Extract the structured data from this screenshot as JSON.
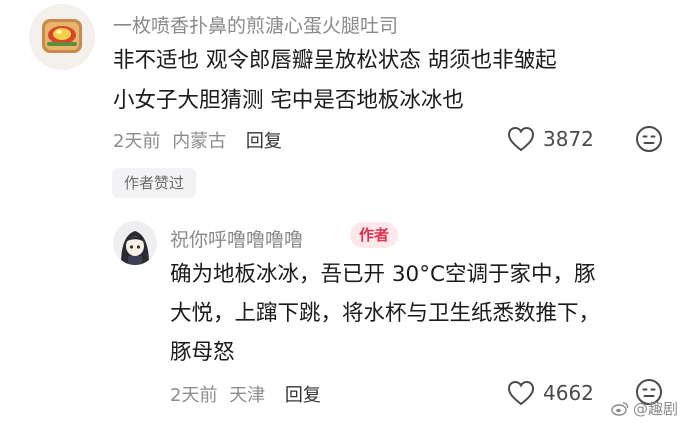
{
  "comment": {
    "username": "一枚喷香扑鼻的煎溏心蛋火腿吐司",
    "lines": [
      "非不适也  观令郎唇瓣呈放松状态  胡须也非皱起",
      "小女子大胆猜测  宅中是否地板冰冰也"
    ],
    "time": "2天前",
    "location": "内蒙古",
    "reply_label": "回复",
    "likes": "3872"
  },
  "author_liked": "作者赞过",
  "reply": {
    "username": "祝你呼噜噜噜噜",
    "badge": "作者",
    "lines": [
      "确为地板冰冰，吾已开 30°C空调于家中，豚",
      "大悦，上蹿下跳，将水杯与卫生纸悉数推下，",
      "豚母怒"
    ],
    "time": "2天前",
    "location": "天津",
    "reply_label": "回复",
    "likes": "4662"
  },
  "watermark": "@趣剧",
  "icons": {
    "like": "heart-outline-icon",
    "dislike": "neutral-face-icon",
    "weibo": "weibo-logo-icon"
  },
  "colors": {
    "author_badge_bg": "#fde9ec",
    "author_badge_text": "#e0314e",
    "meta_text": "#8d8d8d"
  }
}
